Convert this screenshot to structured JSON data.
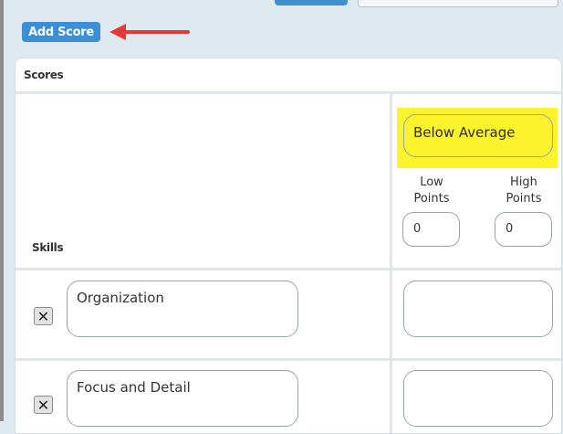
{
  "toolbar": {
    "add_score_label": "Add Score"
  },
  "scores_panel": {
    "header": "Scores",
    "skills_column_label": "Skills",
    "score_columns": [
      {
        "name": "Below Average",
        "low_points_label": "Low\nPoints",
        "high_points_label": "High\nPoints",
        "low_points_value": "0",
        "high_points_value": "0"
      }
    ],
    "skills": [
      {
        "name": "Organization",
        "remove_icon": "close-icon",
        "score_value": ""
      },
      {
        "name": "Focus and Detail",
        "remove_icon": "close-icon",
        "score_value": ""
      }
    ]
  },
  "annotation": {
    "arrow_color": "#e53935"
  },
  "colors": {
    "accent": "#3a8fd6",
    "highlight": "#fbf42d",
    "background": "#dfeaf0"
  }
}
